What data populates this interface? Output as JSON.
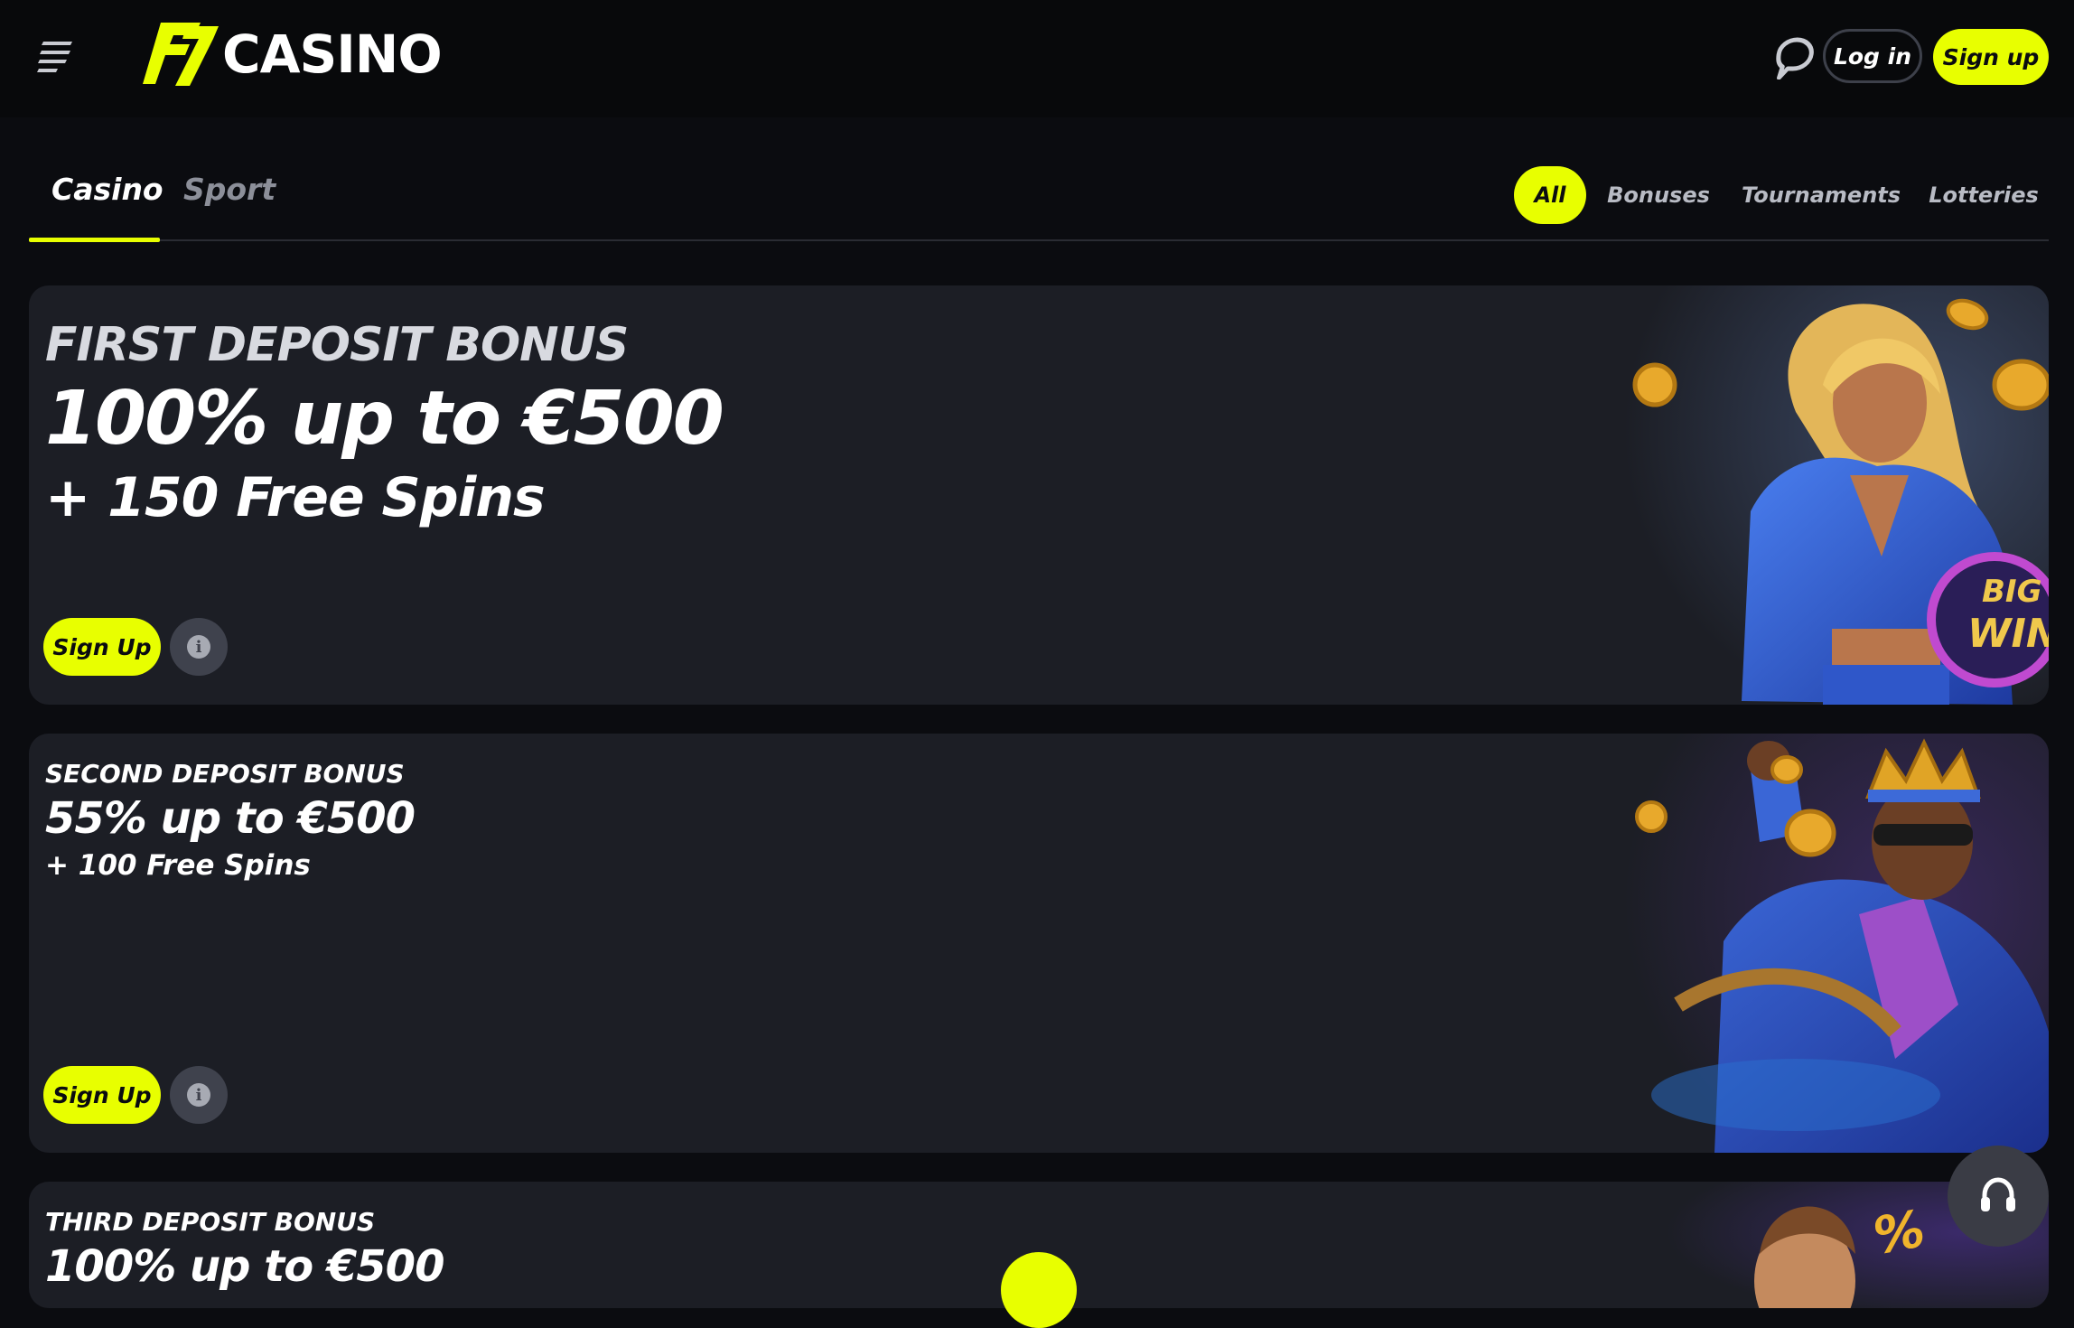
{
  "colors": {
    "accent": "#e8ff00",
    "background": "#0b0c10",
    "card": "#1c1e25",
    "muted": "#8c8f99"
  },
  "header": {
    "logo_text": "CASINO",
    "logo_mark": "F7",
    "menu_icon": "hamburger-menu-icon",
    "chat_icon": "chat-bubble-icon",
    "login_label": "Log in",
    "signup_label": "Sign up"
  },
  "tabs": {
    "main": [
      {
        "label": "Casino",
        "active": true
      },
      {
        "label": "Sport",
        "active": false
      }
    ],
    "filters": [
      {
        "label": "All",
        "active": true
      },
      {
        "label": "Bonuses",
        "active": false
      },
      {
        "label": "Tournaments",
        "active": false
      },
      {
        "label": "Lotteries",
        "active": false
      }
    ]
  },
  "bonuses": [
    {
      "title": "FIRST DEPOSIT BONUS",
      "amount": "100% up to €500",
      "spins": "+ 150 Free Spins",
      "cta": "Sign Up",
      "info_icon": "info-icon"
    },
    {
      "title": "SECOND DEPOSIT BONUS",
      "amount": "55% up to €500",
      "spins": "+ 100 Free Spins",
      "cta": "Sign Up",
      "info_icon": "info-icon"
    },
    {
      "title": "THIRD DEPOSIT BONUS",
      "amount": "100% up to €500"
    }
  ],
  "art": {
    "card1_badge_top": "BIG",
    "card1_badge_bottom": "WIN",
    "card3_badge": "%"
  },
  "support": {
    "icon": "headset-icon"
  }
}
